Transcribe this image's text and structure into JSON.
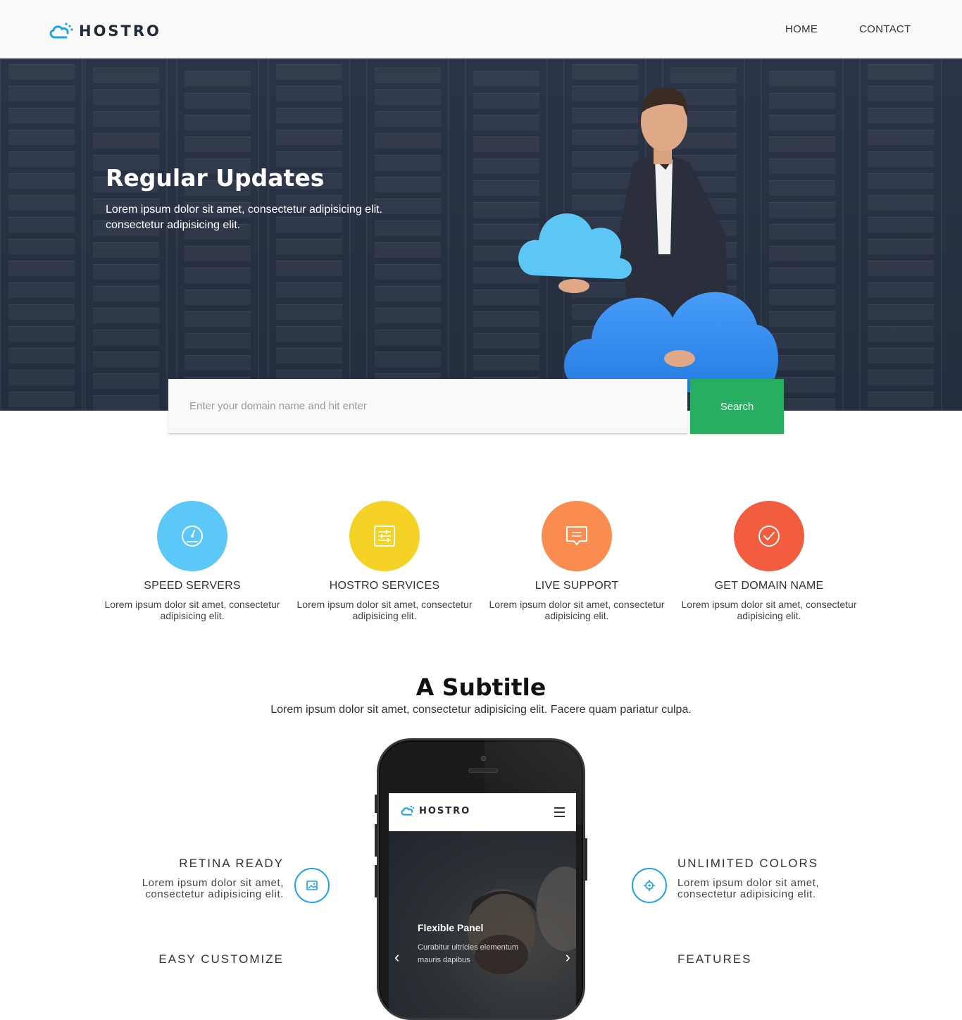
{
  "header": {
    "logo_text": "HOSTRO",
    "nav": [
      {
        "label": "HOME"
      },
      {
        "label": "CONTACT"
      }
    ]
  },
  "hero": {
    "title": "Regular Updates",
    "subtitle": "Lorem ipsum dolor sit amet, consectetur adipisicing elit. consectetur adipisicing elit."
  },
  "search": {
    "placeholder": "Enter your domain name and hit enter",
    "button_label": "Search"
  },
  "features": [
    {
      "title": "SPEED SERVERS",
      "desc": "Lorem ipsum dolor sit amet, consectetur adipisicing elit.",
      "color": "#5bc8f7",
      "icon": "speedometer-icon"
    },
    {
      "title": "HOSTRO SERVICES",
      "desc": "Lorem ipsum dolor sit amet, consectetur adipisicing elit.",
      "color": "#f5d226",
      "icon": "sliders-icon"
    },
    {
      "title": "LIVE SUPPORT",
      "desc": "Lorem ipsum dolor sit amet, consectetur adipisicing elit.",
      "color": "#fb8c4f",
      "icon": "chat-icon"
    },
    {
      "title": "GET DOMAIN NAME",
      "desc": "Lorem ipsum dolor sit amet, consectetur adipisicing elit.",
      "color": "#f25c3f",
      "icon": "check-circle-icon"
    }
  ],
  "section": {
    "title": "A Subtitle",
    "desc": "Lorem ipsum dolor sit amet, consectetur adipisicing elit. Facere quam pariatur culpa."
  },
  "side_features": [
    {
      "title": "RETINA READY",
      "desc": "Lorem ipsum dolor sit amet, consectetur adipisicing elit.",
      "icon": "image-icon"
    },
    {
      "title": "UNLIMITED COLORS",
      "desc": "Lorem ipsum dolor sit amet, consectetur adipisicing elit.",
      "icon": "crosshair-icon"
    },
    {
      "title": "EASY CUSTOMIZE"
    },
    {
      "title": "FEATURES"
    }
  ],
  "phone": {
    "logo_text": "HOSTRO",
    "slide_title": "Flexible Panel",
    "slide_desc": "Curabitur ultricies elementum mauris dapibus",
    "prev": "‹",
    "next": "›"
  },
  "colors": {
    "accent": "#1aa3e8",
    "search_button": "#27ae60",
    "hero_bg": "#2a3446"
  }
}
